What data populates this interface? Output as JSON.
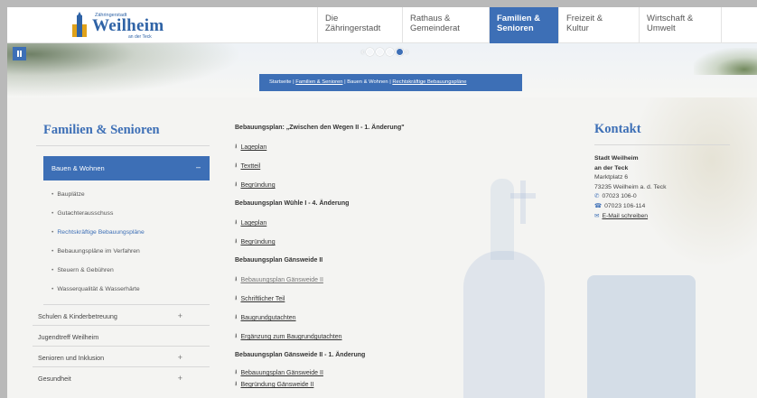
{
  "header": {
    "logo": {
      "small": "Zähringerstadt",
      "name": "Weilheim",
      "sub": "an der Teck"
    },
    "nav": [
      {
        "line1": "Die",
        "line2": "Zähringerstadt"
      },
      {
        "line1": "Rathaus &",
        "line2": "Gemeinderat"
      },
      {
        "line1": "Familien &",
        "line2": "Senioren"
      },
      {
        "line1": "Freizeit &",
        "line2": "Kultur"
      },
      {
        "line1": "Wirtschaft &",
        "line2": "Umwelt"
      }
    ]
  },
  "slider": {
    "prev": "‹",
    "next": "›"
  },
  "breadcrumb": {
    "home": "Startseite",
    "sep": "|",
    "level1": "Familien & Senioren",
    "level2": "Bauen & Wohnen",
    "current": "Rechtskräftige Bebauungspläne"
  },
  "sidebar": {
    "title": "Familien & Senioren",
    "active": {
      "label": "Bauen & Wohnen",
      "toggle": "–"
    },
    "sub_items": [
      "Bauplätze",
      "Gutachterausschuss",
      "Rechtskräftige Bebauungspläne",
      "Bebauungspläne im Verfahren",
      "Steuern & Gebühren",
      "Wasserqualität & Wasserhärte"
    ],
    "items": [
      {
        "label": "Schulen & Kinderbetreuung",
        "toggle": "+"
      },
      {
        "label": "Jugendtreff Weilheim",
        "toggle": ""
      },
      {
        "label": "Senioren und Inklusion",
        "toggle": "+"
      },
      {
        "label": "Gesundheit",
        "toggle": "+"
      }
    ]
  },
  "main": {
    "groups": [
      {
        "title": "Bebauungsplan: „Zwischen den Wegen II - 1. Änderung\"",
        "links": [
          "Lageplan",
          "Textteil",
          "Begründung"
        ]
      },
      {
        "title": "Bebauungsplan Wühle I - 4. Änderung",
        "links": [
          "Lageplan",
          "Begründung"
        ]
      },
      {
        "title": "Bebauungsplan Gänsweide II",
        "links": [
          "Bebauungsplan Gänsweide II",
          "Schriftlicher Teil",
          "Baugrundgutachten",
          "Ergänzung zum Baugrundgutachten"
        ]
      },
      {
        "title": "Bebauungsplan Gänsweide II - 1. Änderung",
        "links": [
          "Bebauungsplan Gänsweide II",
          "Begründung Gänsweide II"
        ]
      }
    ],
    "download_icon": "⭳"
  },
  "contact": {
    "title": "Kontakt",
    "org1": "Stadt Weilheim",
    "org2": "an der Teck",
    "street": "Marktplatz 6",
    "city": "73235 Weilheim a. d. Teck",
    "phone": "07023 106-0",
    "fax": "07023 106-114",
    "email_label": "E-Mail schreiben",
    "phone_icon": "✆",
    "fax_icon": "☎",
    "mail_icon": "✉"
  },
  "colors": {
    "accent": "#3d6fb6",
    "background": "#f4f4f2"
  }
}
